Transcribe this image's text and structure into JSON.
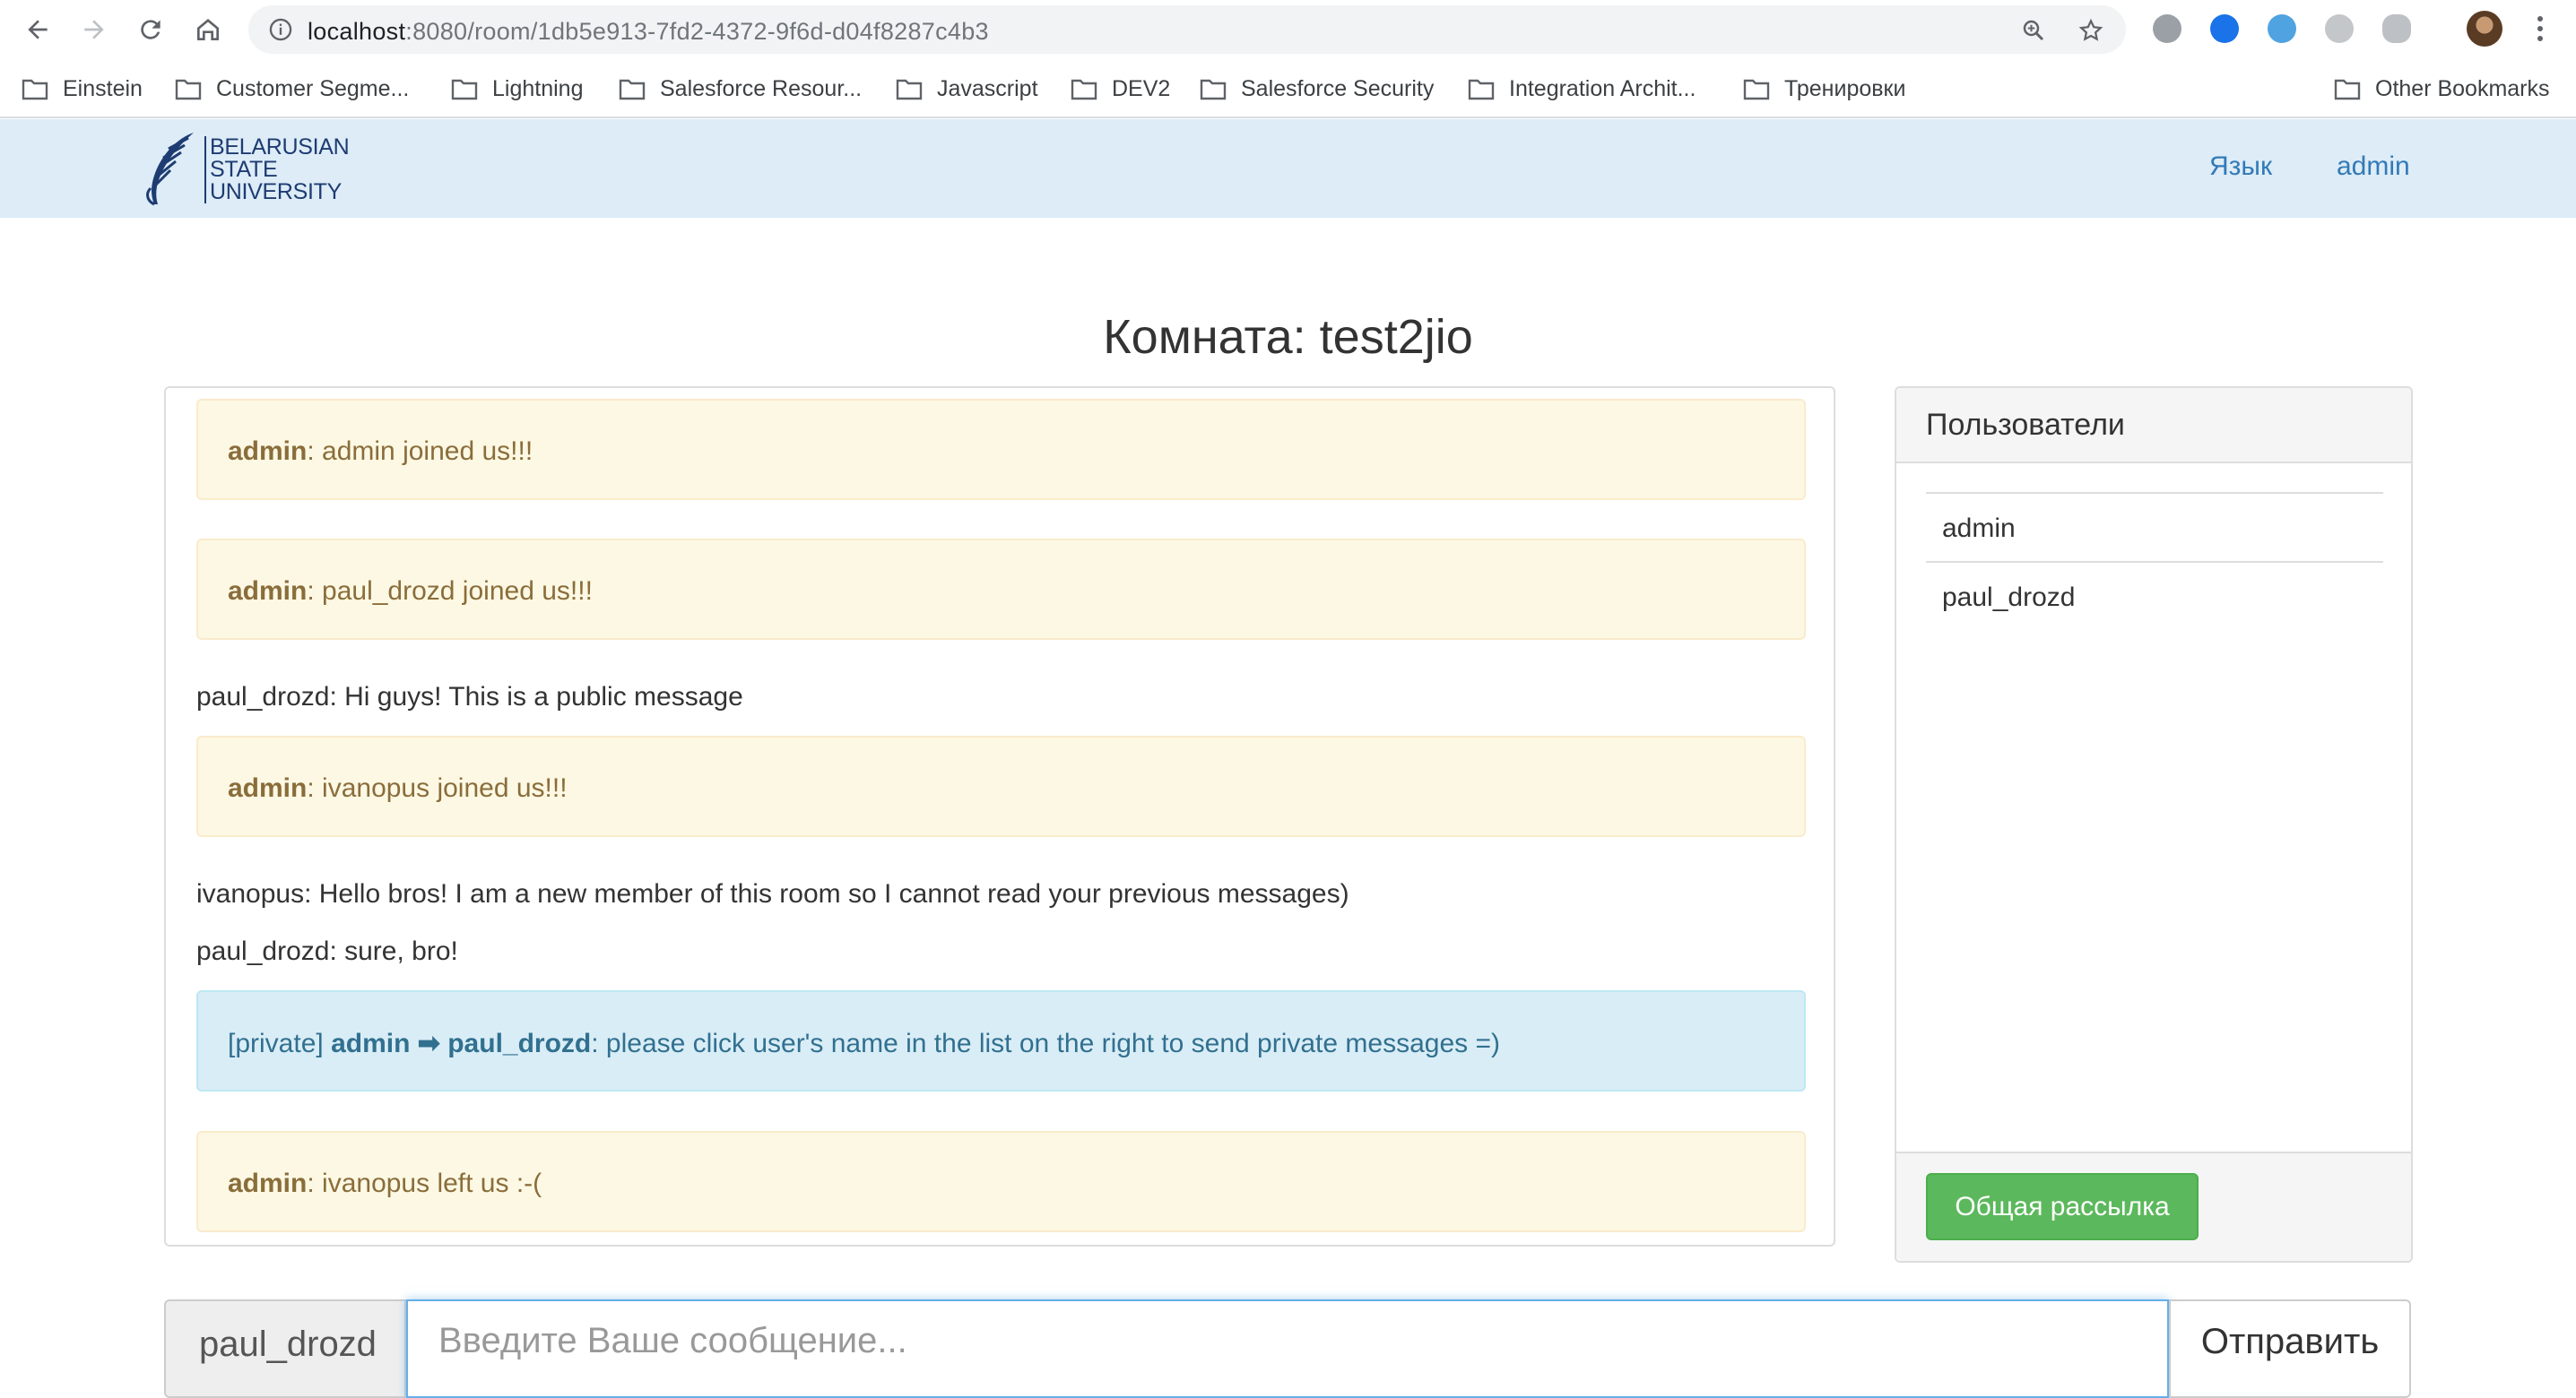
{
  "browser": {
    "url_host": "localhost",
    "url_rest": ":8080/room/1db5e913-7fd2-4372-9f6d-d04f8287c4b3",
    "bookmarks": [
      {
        "label": "Einstein"
      },
      {
        "label": "Customer Segme..."
      },
      {
        "label": "Lightning"
      },
      {
        "label": "Salesforce Resour..."
      },
      {
        "label": "Javascript"
      },
      {
        "label": "DEV2"
      },
      {
        "label": "Salesforce Security"
      },
      {
        "label": "Integration Archit..."
      },
      {
        "label": "Тренировки"
      }
    ],
    "other_bookmarks": "Other Bookmarks"
  },
  "navbar": {
    "logo_lines": [
      "BELARUSIAN",
      "STATE",
      "UNIVERSITY"
    ],
    "language_link": "Язык",
    "user_link": "admin"
  },
  "room": {
    "title": "Комната: test2jio"
  },
  "messages": [
    {
      "type": "system",
      "author": "admin",
      "text": ": admin joined us!!!"
    },
    {
      "type": "system",
      "author": "admin",
      "text": ": paul_drozd joined us!!!"
    },
    {
      "type": "public",
      "text": "paul_drozd: Hi guys! This is a public message"
    },
    {
      "type": "system",
      "author": "admin",
      "text": ": ivanopus joined us!!!"
    },
    {
      "type": "public",
      "text": "ivanopus: Hello bros! I am a new member of this room so I cannot read your previous messages)"
    },
    {
      "type": "public",
      "text": "paul_drozd: sure, bro!"
    },
    {
      "type": "private",
      "prefix": "[private] ",
      "from": "admin",
      "arrow": " ➡ ",
      "to": "paul_drozd",
      "text": ": please click user's name in the list on the right to send private messages =)"
    },
    {
      "type": "system",
      "author": "admin",
      "text": ": ivanopus left us :-("
    }
  ],
  "users_panel": {
    "heading": "Пользователи",
    "users": [
      "admin",
      "paul_drozd"
    ],
    "broadcast_button": "Общая рассылка"
  },
  "composer": {
    "current_user": "paul_drozd",
    "placeholder": "Введите Ваше сообщение...",
    "send_button": "Отправить"
  },
  "colors": {
    "navbar_bg": "#ddecf7",
    "link": "#337ab7",
    "warning_bg": "#fcf8e3",
    "warning_text": "#8a6d3b",
    "info_bg": "#d9edf7",
    "info_text": "#31708f",
    "success_button": "#5cb85c"
  }
}
